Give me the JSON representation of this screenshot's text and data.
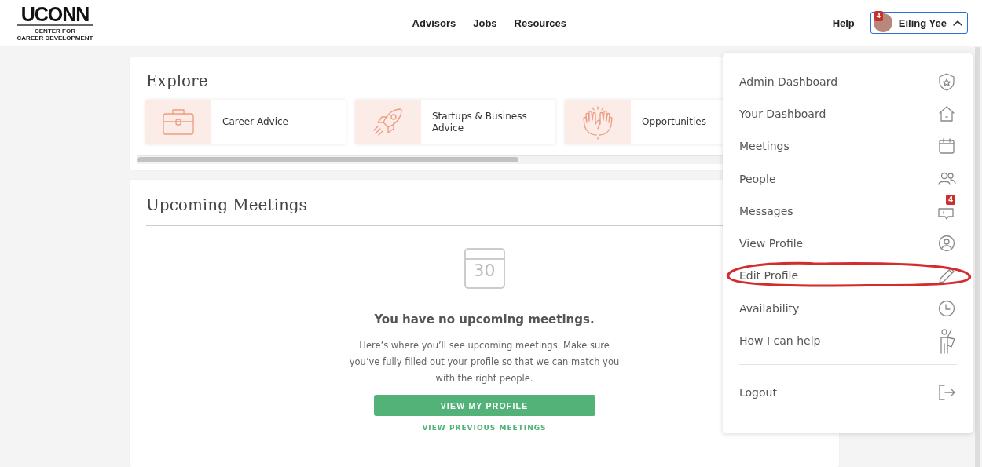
{
  "logo": {
    "wordmark": "UCONN",
    "subtitle": [
      "CENTER FOR",
      "CAREER DEVELOPMENT"
    ]
  },
  "nav": [
    "Advisors",
    "Jobs",
    "Resources"
  ],
  "help": "Help",
  "user": {
    "name": "Eiling Yee",
    "badge": "4",
    "expanded": true
  },
  "explore": {
    "title": "Explore",
    "tiles": [
      {
        "label": "Career Advice"
      },
      {
        "label": "Startups & Business Advice"
      },
      {
        "label": "Opportunities"
      }
    ]
  },
  "meetings": {
    "title": "Upcoming Meetings",
    "empty_title": "You have no upcoming meetings.",
    "calendar_day": "30",
    "empty_text": "Here’s where you’ll see upcoming meetings. Make sure you’ve fully filled out your profile so that we can match you with the right people.",
    "primary_button": "VIEW MY PROFILE",
    "secondary_link": "VIEW PREVIOUS MEETINGS"
  },
  "menu": [
    {
      "label": "Admin Dashboard",
      "circled": false
    },
    {
      "label": "Your Dashboard",
      "circled": false
    },
    {
      "label": "Meetings",
      "circled": false
    },
    {
      "label": "People",
      "circled": false
    },
    {
      "label": "Messages",
      "circled": false,
      "badge": "4"
    },
    {
      "label": "View Profile",
      "circled": false
    },
    {
      "label": "Edit Profile",
      "circled": true
    },
    {
      "label": "Availability",
      "circled": false
    },
    {
      "label": "How I can help",
      "circled": false
    },
    {
      "label": "Logout",
      "circled": false,
      "separated": true
    }
  ]
}
